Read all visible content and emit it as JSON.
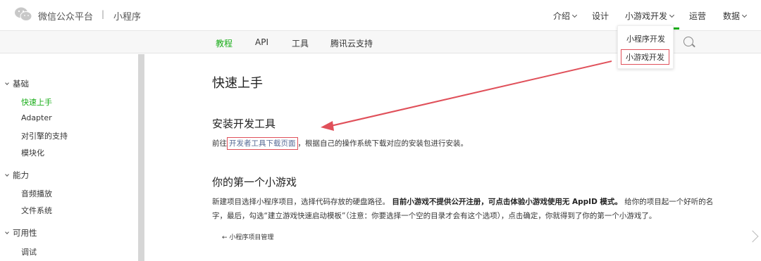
{
  "header": {
    "brand": "微信公众平台",
    "separator": "|",
    "sub_brand": "小程序",
    "nav": [
      {
        "label": "介绍",
        "has_menu": true
      },
      {
        "label": "设计",
        "has_menu": false
      },
      {
        "label": "小游戏开发",
        "has_menu": true
      },
      {
        "label": "运营",
        "has_menu": false
      },
      {
        "label": "数据",
        "has_menu": true
      }
    ],
    "dropdown": [
      "小程序开发",
      "小游戏开发"
    ]
  },
  "subnav": [
    "教程",
    "API",
    "工具",
    "腾讯云支持"
  ],
  "sidebar": {
    "groups": [
      {
        "label": "基础",
        "items": [
          "快速上手",
          "Adapter",
          "对引擎的支持",
          "模块化"
        ]
      },
      {
        "label": "能力",
        "items": [
          "音频播放",
          "文件系统"
        ]
      },
      {
        "label": "可用性",
        "items": [
          "调试"
        ]
      }
    ]
  },
  "main": {
    "title": "快速上手",
    "section1_title": "安装开发工具",
    "section1_prefix": "前往",
    "section1_link": "开发者工具下载页面",
    "section1_suffix": "，根据自己的操作系统下载对应的安装包进行安装。",
    "section2_title": "你的第一个小游戏",
    "section2_line1_a": "新建项目选择小程序项目，选择代码存放的硬盘路径。",
    "section2_line1_bold": "目前小游戏不提供公开注册，可点击体验小游戏使用无 AppID 模式。",
    "section2_line1_b": "给你的项目起一个好听的名",
    "section2_line2": "字，最后，勾选“建立游戏快速启动模板”（注意：你要选择一个空的目录才会有这个选项），点击确定，你就得到了你的第一个小游戏了。",
    "back_link": "← 小程序项目管理"
  },
  "colors": {
    "accent": "#1aad19",
    "link": "#576b95",
    "annotation": "#e0505a"
  }
}
